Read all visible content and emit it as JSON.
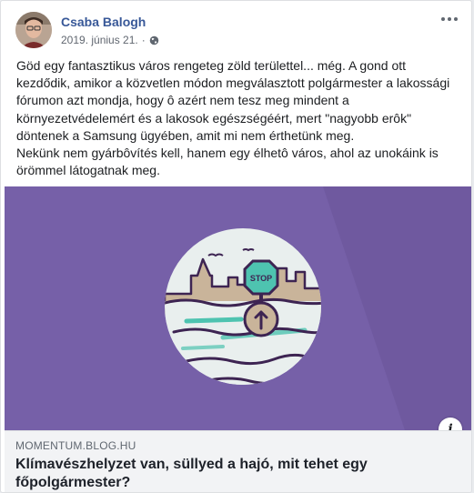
{
  "post": {
    "author": "Csaba Balogh",
    "date": "2019. június 21.",
    "separator": "·",
    "privacy_icon": "globe-icon",
    "more_icon": "more-options-icon",
    "paragraph1": "Göd egy fantasztikus város rengeteg zöld területtel... még. A gond ott kezdődik, amikor a közvetlen módon megválasztott polgármester a lakossági fórumon azt mondja, hogy ô azért nem tesz meg mindent a környezetvédelemért és a lakosok egészségéért, mert \"nagyobb erôk\" döntenek a Samsung ügyében, amit mi nem érthetünk meg.",
    "paragraph2": "Nekünk nem gyárbôvítés kell, hanem egy élhetô város, ahol az unokáink is örömmel látogatnak meg."
  },
  "link_preview": {
    "image_sign_text": "STOP",
    "info_label": "i",
    "domain": "momentum.blog.hu",
    "title": "Klímavészhelyzet van, süllyed a hajó, mit tehet egy főpolgármester?"
  },
  "colors": {
    "author": "#385898",
    "image_bg": "#7660a8",
    "circle": "#e9efee",
    "water_line": "#3d2452",
    "city": "#c9b49a",
    "sign": "#4ec3b0"
  }
}
